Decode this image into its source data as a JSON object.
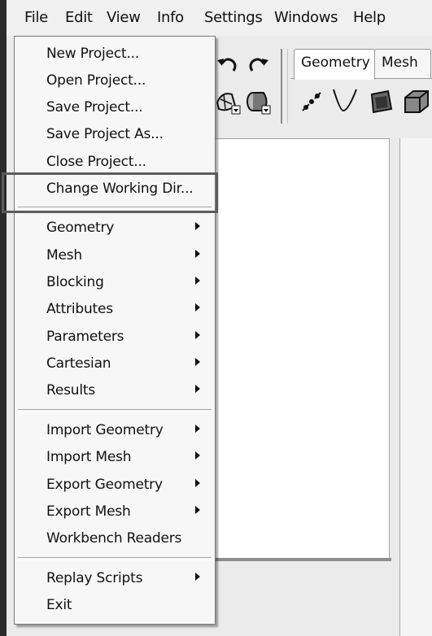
{
  "menubar": {
    "items": [
      "File",
      "Edit",
      "View",
      "Info",
      "Settings",
      "Windows",
      "Help"
    ]
  },
  "tabs": [
    "Geometry",
    "Mesh"
  ],
  "file_menu": {
    "group1": [
      {
        "label": "New Project..."
      },
      {
        "label": "Open Project..."
      },
      {
        "label": "Save Project..."
      },
      {
        "label": "Save Project As..."
      },
      {
        "label": "Close Project..."
      },
      {
        "label": "Change Working Dir..."
      }
    ],
    "group2": [
      {
        "label": "Geometry",
        "submenu": true
      },
      {
        "label": "Mesh",
        "submenu": true
      },
      {
        "label": "Blocking",
        "submenu": true
      },
      {
        "label": "Attributes",
        "submenu": true
      },
      {
        "label": "Parameters",
        "submenu": true
      },
      {
        "label": "Cartesian",
        "submenu": true
      },
      {
        "label": "Results",
        "submenu": true
      }
    ],
    "group3": [
      {
        "label": "Import Geometry",
        "submenu": true
      },
      {
        "label": "Import Mesh",
        "submenu": true
      },
      {
        "label": "Export Geometry",
        "submenu": true
      },
      {
        "label": "Export Mesh",
        "submenu": true
      },
      {
        "label": "Workbench Readers",
        "submenu": false
      }
    ],
    "group4": [
      {
        "label": "Replay Scripts",
        "submenu": true
      },
      {
        "label": "Exit",
        "submenu": false
      }
    ],
    "highlighted_item": "Change Working Dir..."
  },
  "toolbar_icons": [
    "undo-icon",
    "redo-icon",
    "geometry-shape-icon",
    "cylinder-icon",
    "create-point-icon",
    "create-curve-icon",
    "create-surface-icon",
    "create-body-icon"
  ]
}
